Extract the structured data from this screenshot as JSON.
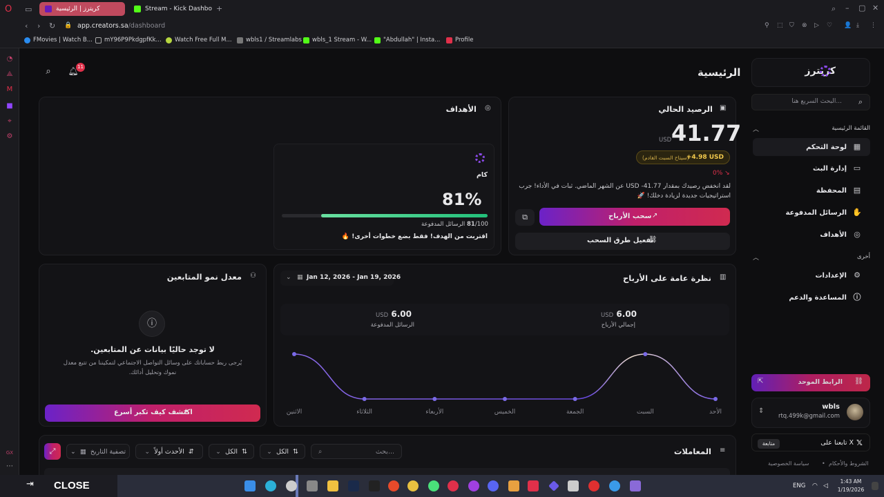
{
  "browser": {
    "tabs": [
      {
        "label": "كريترز | الرئيسية"
      },
      {
        "label": "Stream - Kick Dashbo"
      }
    ],
    "url_host": "app.creators.sa",
    "url_path": "/dashboard",
    "bookmarks": [
      "FMovies | Watch B...",
      "mY96P9PkdgpfKk...",
      "Watch Free Full M...",
      "wbls1 / Streamlabs",
      "wbls_1 Stream - W...",
      "\"Abdullah\" | Insta...",
      "Profile"
    ]
  },
  "header": {
    "page_title": "الرئيسية",
    "notif_count": "11"
  },
  "sidebar": {
    "brand": "كريترز",
    "search_placeholder": "البحث السريع هنا...",
    "main_section": "القائمة الرئيسية",
    "items": [
      {
        "label": "لوحة التحكم",
        "icon": "dashboard-icon"
      },
      {
        "label": "إدارة البث",
        "icon": "stream-icon"
      },
      {
        "label": "المحفظة",
        "icon": "wallet-icon"
      },
      {
        "label": "الرسائل المدفوعة",
        "icon": "hand-coin-icon"
      },
      {
        "label": "الأهداف",
        "icon": "target-icon"
      }
    ],
    "other_section": "أخرى",
    "other_items": [
      {
        "label": "الإعدادات",
        "icon": "gear-icon"
      },
      {
        "label": "المساعدة والدعم",
        "icon": "info-icon"
      }
    ],
    "unified_link": "الرابط الموحد",
    "user_name": "wbls",
    "user_email": "rtq.499k@gmail.com",
    "follow_x": "تابعنا على X",
    "follow_btn": "متابعة",
    "terms": "الشروط والأحكام",
    "privacy": "سياسة الخصوصية"
  },
  "balance": {
    "title": "الرصيد الحالي",
    "amount": "41.77",
    "currency": "USD",
    "next_badge": "+4.98 USD",
    "next_label": "(سيتاح السبت القادم)",
    "change": "0%",
    "desc": "لقد انخفض رصيدك بمقدار 41.77- USD عن الشهر الماضي. ثبات في الأداء! جرب استراتيجيات جديدة لزيادة دخلك! 🚀",
    "withdraw": "سحب الأرباح",
    "activate": "تفعيل طرق السحب"
  },
  "goals": {
    "title": "الأهداف",
    "goal_name": "كام",
    "percent": "81%",
    "progress": 0.81,
    "count": "81",
    "total": "/100",
    "count_label": "الرسائل المدفوعة",
    "hint": "اقتربت من الهدف! فقط بضع خطوات أخرى! 🔥"
  },
  "earnings": {
    "title": "نظرة عامة على الأرباح",
    "date_range": "Jan 12, 2026 - Jan 19, 2026",
    "total_value": "6.00",
    "total_label": "إجمالي الأرباح",
    "paid_value": "6.00",
    "paid_label": "الرسائل المدفوعة",
    "currency": "USD"
  },
  "chart_data": {
    "type": "line",
    "categories": [
      "الأحد",
      "السبت",
      "الجمعة",
      "الخميس",
      "الأربعاء",
      "الثلاثاء",
      "الاثنين"
    ],
    "values": [
      0,
      3,
      0,
      0,
      0,
      0,
      3
    ],
    "grid": false,
    "ylim": [
      0,
      3.6
    ]
  },
  "followers": {
    "title": "معدل نمو المتابعين",
    "empty_title": "لا توجد حاليًا بيانات عن المتابعين.",
    "empty_desc1": "يُرجى ربط حساباتك على وسائل التواصل الاجتماعي لتمكيننا من تتبع معدل",
    "empty_desc2": "نموك وتحليل أدائك.",
    "cta": "اكتشف كيف تكبر أسرع"
  },
  "transactions": {
    "title": "المعاملات",
    "search_placeholder": "بحث...",
    "filter_all1": "الكل",
    "filter_all2": "الكل",
    "sort": "الأحدث أولاً",
    "date_filter": "تصفية التاريخ"
  },
  "overlay": {
    "close": "CLOSE"
  },
  "taskbar": {
    "lang": "ENG",
    "time": "1:43 AM",
    "date": "1/19/2026"
  }
}
